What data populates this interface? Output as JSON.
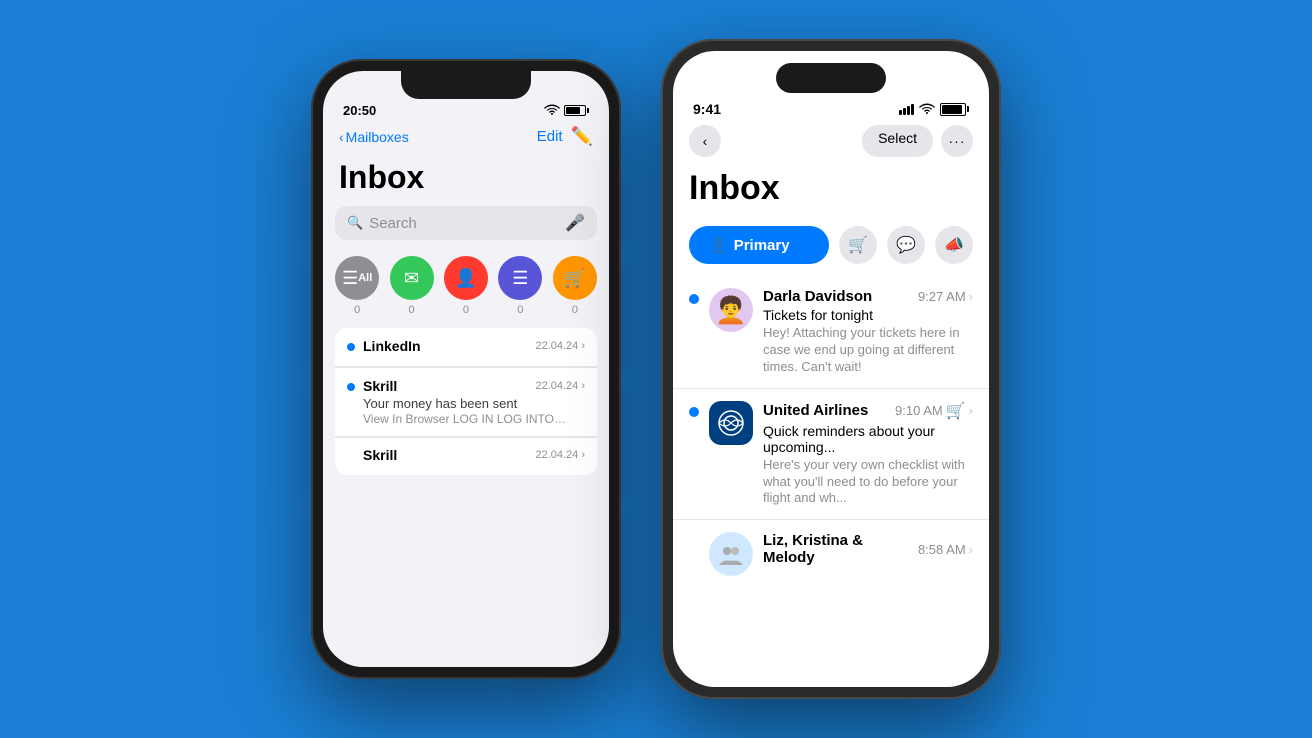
{
  "background_color": "#1a7fd4",
  "phone1": {
    "status": {
      "time": "20:50"
    },
    "nav": {
      "back_label": "Mailboxes",
      "edit_label": "Edit"
    },
    "title": "Inbox",
    "search": {
      "placeholder": "Search"
    },
    "filters": [
      {
        "label": "All",
        "icon": "📥",
        "count": "0",
        "type": "all"
      },
      {
        "label": "",
        "icon": "✉️",
        "count": "0",
        "type": "unread"
      },
      {
        "label": "",
        "icon": "👤",
        "count": "0",
        "type": "contacts"
      },
      {
        "label": "",
        "icon": "📄",
        "count": "0",
        "type": "docs"
      },
      {
        "label": "",
        "icon": "🛒",
        "count": "0",
        "type": "shopping"
      }
    ],
    "emails": [
      {
        "sender": "LinkedIn",
        "time": "22.04.24",
        "subject": "",
        "preview": "",
        "unread": true
      },
      {
        "sender": "Skrill",
        "time": "22.04.24",
        "subject": "Your money has been sent",
        "preview": "View In Browser LOG IN LOG INTO YOUR ACCOUNT DOWNLOAD OUR APP TALK TO US Hi S...",
        "unread": true
      },
      {
        "sender": "Skrill",
        "time": "22.04.24",
        "subject": "",
        "preview": "",
        "unread": false
      }
    ]
  },
  "phone2": {
    "status": {
      "time": "9:41"
    },
    "nav": {
      "select_label": "Select",
      "more_label": "···"
    },
    "title": "Inbox",
    "tabs": [
      {
        "label": "Primary",
        "active": true
      },
      {
        "label": "Shopping",
        "icon": "🛒"
      },
      {
        "label": "Chat",
        "icon": "💬"
      },
      {
        "label": "Promo",
        "icon": "📣"
      }
    ],
    "emails": [
      {
        "sender": "Darla Davidson",
        "time": "9:27 AM",
        "subject": "Tickets for tonight",
        "preview": "Hey! Attaching your tickets here in case we end up going at different times. Can't wait!",
        "unread": true,
        "avatar": "🧑‍🦱"
      },
      {
        "sender": "United Airlines",
        "time": "9:10 AM",
        "subject": "Quick reminders about your upcoming...",
        "preview": "Here's your very own checklist with what you'll need to do before your flight and wh...",
        "unread": true,
        "avatar": "✈️",
        "badge": "🛒"
      },
      {
        "sender": "Liz, Kristina & Melody",
        "time": "8:58 AM",
        "subject": "",
        "preview": "",
        "unread": false,
        "avatar": "👥"
      }
    ]
  }
}
